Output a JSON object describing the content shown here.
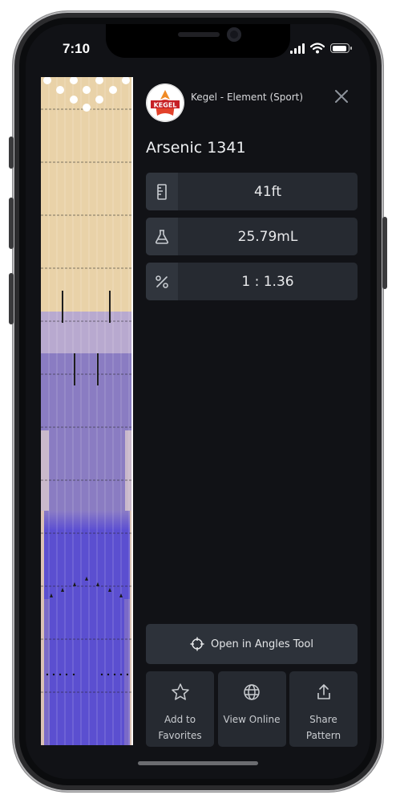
{
  "status_bar": {
    "time": "7:10"
  },
  "pattern": {
    "brand_name": "Kegel - Element (Sport)",
    "logo_text": "KEGEL",
    "title": "Arsenic 1341",
    "length": "41ft",
    "volume": "25.79mL",
    "ratio": "1 : 1.36"
  },
  "icons": {
    "length": "ruler-icon",
    "volume": "flask-icon",
    "ratio": "percent-icon",
    "close": "close-icon",
    "angles": "crosshair-icon",
    "favorites": "star-icon",
    "online": "globe-icon",
    "share": "share-icon"
  },
  "actions": {
    "angles_tool": "Open in Angles Tool",
    "favorites_line1": "Add to",
    "favorites_line2": "Favorites",
    "view_online": "View Online",
    "share_line1": "Share",
    "share_line2": "Pattern"
  },
  "colors": {
    "lane_wood": "#e9d2a8",
    "oil_light": "#b7a8cf",
    "oil_mid": "#7d6fc0",
    "oil_heavy": "#5b4fd0",
    "panel": "#262a31"
  }
}
